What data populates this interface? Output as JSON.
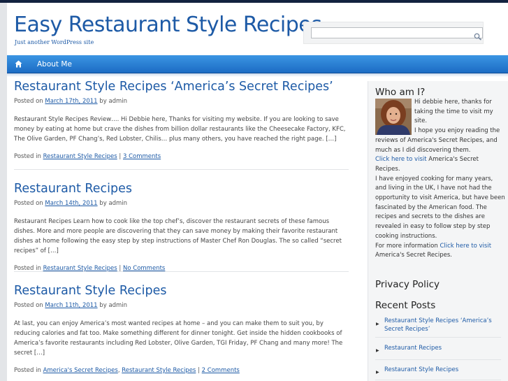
{
  "header": {
    "site_title": "Easy Restaurant Style Recipes",
    "tagline": "Just another WordPress site",
    "search_placeholder": ""
  },
  "nav": {
    "home_icon": "home-icon",
    "items": [
      {
        "label": "About Me"
      }
    ]
  },
  "posts": [
    {
      "title": "Restaurant Style Recipes ‘America’s Secret Recipes’",
      "posted_on": "Posted on",
      "date": "March 17th, 2011",
      "by": "by",
      "author": "admin",
      "excerpt": "  Restaurant Style Recipes Review….   Hi Debbie here, Thanks for visiting my website.   If you are looking to save money by eating at home but crave the dishes from billion dollar restaurants like the Cheesecake Factory, KFC, The Olive Garden, PF Chang’s, Red Lobster, Chilis… plus many others, you have reached the right page. […]",
      "posted_in": "Posted in",
      "categories": [
        "Restaurant Style Recipes"
      ],
      "sep": "|",
      "comments": "3 Comments"
    },
    {
      "title": "Restaurant Recipes",
      "posted_on": "Posted on",
      "date": "March 14th, 2011",
      "by": "by",
      "author": "admin",
      "excerpt": "Restaurant Recipes Learn how to cook like the top chef’s, discover the restaurant secrets of these famous dishes. More and more people are discovering that they can save money by making their favorite restaurant dishes at home following the easy step by step instructions of Master Chef Ron Douglas.  The so called “secret recipes” of […]",
      "posted_in": "Posted in",
      "categories": [
        "Restaurant Style Recipes"
      ],
      "sep": "|",
      "comments": "No Comments"
    },
    {
      "title": "Restaurant Style Recipes",
      "posted_on": "Posted on",
      "date": "March 11th, 2011",
      "by": "by",
      "author": "admin",
      "excerpt": "At last, you can enjoy America’s most wanted recipes at home – and you can make them to suit you, by reducing calories and fat too. Make something different for dinner tonight. Get inside the hidden cookbooks of America’s favorite restaurants including Red Lobster, Olive Garden, TGI Friday, PF Chang and many more! The secret […]",
      "posted_in": "Posted in",
      "categories": [
        "America's Secret Recipes",
        "Restaurant Style Recipes"
      ],
      "cat_sep": ",",
      "sep": "|",
      "comments": "2 Comments"
    }
  ],
  "sidebar": {
    "about": {
      "heading": "Who am I?",
      "p1": "Hi debbie here, thanks for taking the time to visit my site.",
      "p2": "I hope you enjoy reading the reviews of America's Secret Recipes, and much as I did discovering them.",
      "link1": "Click here to visit",
      "p3": " America's Secret Recipes.",
      "p4": "I have enjoyed cooking for many years, and living in the UK, I have not had the opportunity to visit America, but have been fascinated by the American food. The recipes and secrets to the dishes are revealed in easy to follow step by step cooking instructions.",
      "p5": "For more information ",
      "link2": "Click here to visit",
      "p6": " America's Secret Recipes."
    },
    "privacy_heading": "Privacy Policy",
    "recent_heading": "Recent Posts",
    "recent_posts": [
      "Restaurant Style Recipes ‘America’s Secret Recipes’",
      "Restaurant Recipes",
      "Restaurant Style Recipes"
    ],
    "bullet": "▶"
  },
  "colors": {
    "accent": "#1d5aa6",
    "nav_top": "#3b95e3",
    "nav_bottom": "#1c6cc4",
    "topbar": "#13223f"
  }
}
